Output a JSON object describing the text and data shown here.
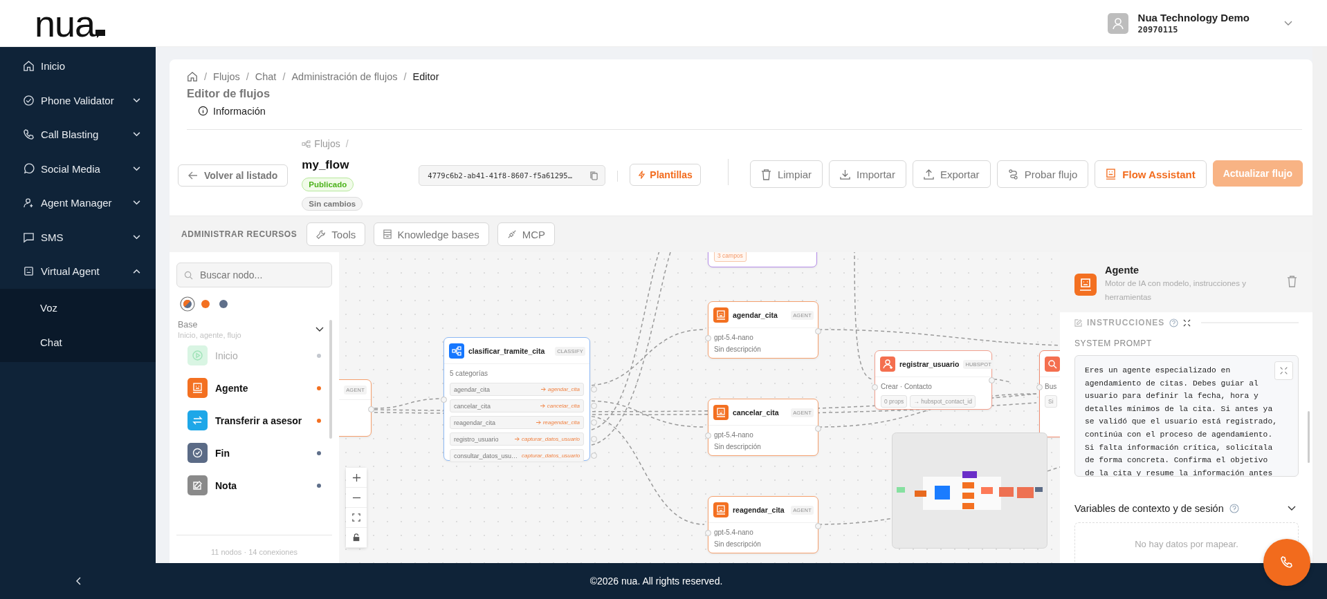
{
  "header": {
    "logo": "nua",
    "user": {
      "name": "Nua Technology Demo",
      "account": "20970115"
    }
  },
  "sidebar": {
    "items": [
      {
        "label": "Inicio",
        "kind": "link"
      },
      {
        "label": "Phone Validator",
        "kind": "group",
        "expanded": false
      },
      {
        "label": "Call Blasting",
        "kind": "group",
        "expanded": false
      },
      {
        "label": "Social Media",
        "kind": "group",
        "expanded": false
      },
      {
        "label": "Agent Manager",
        "kind": "group",
        "expanded": false
      },
      {
        "label": "SMS",
        "kind": "group",
        "expanded": false
      },
      {
        "label": "Virtual Agent",
        "kind": "group",
        "expanded": true,
        "children": [
          {
            "label": "Voz"
          },
          {
            "label": "Chat"
          }
        ]
      }
    ]
  },
  "breadcrumb": {
    "separator": "/",
    "items": [
      "Flujos",
      "Chat",
      "Administración de flujos",
      "Editor"
    ]
  },
  "page_title": "Editor de flujos",
  "tabs": [
    {
      "label": "Información",
      "selected": true
    }
  ],
  "flow": {
    "parent": "Flujos",
    "parent_separator": "/",
    "name": "my_flow",
    "status": "Publicado",
    "changes": "Sin cambios",
    "id": "4779c6b2-ab41-41f8-8607-f5a61295…"
  },
  "back_button": "Volver al listado",
  "templates_button": "Plantillas",
  "actions": [
    {
      "label": "Limpiar",
      "kind": "clear",
      "disabled": false
    },
    {
      "label": "Importar",
      "kind": "import",
      "disabled": false
    },
    {
      "label": "Exportar",
      "kind": "export",
      "disabled": false
    },
    {
      "label": "Probar flujo",
      "kind": "test",
      "disabled": false
    },
    {
      "label": "Flow Assistant",
      "kind": "assistant",
      "disabled": false
    },
    {
      "label": "Actualizar flujo",
      "kind": "update",
      "disabled": true
    }
  ],
  "resources": {
    "title": "ADMINISTRAR RECURSOS",
    "items": [
      {
        "label": "Tools",
        "kind": "tools"
      },
      {
        "label": "Knowledge bases",
        "kind": "knowledge"
      },
      {
        "label": "MCP",
        "kind": "mcp"
      }
    ]
  },
  "palette": {
    "search_placeholder": "Buscar nodo...",
    "filters": [
      {
        "kind": "all",
        "selected": true
      },
      {
        "kind": "single",
        "color": "#f37021",
        "selected": false
      },
      {
        "kind": "single",
        "color": "#5f6f8a",
        "selected": false
      }
    ],
    "section": {
      "title": "Base",
      "subtitle": "Inicio, agente, flujo",
      "expanded": true,
      "items": [
        {
          "label": "Inicio",
          "kind": "start",
          "color": "#c4c8cf",
          "disabled": true
        },
        {
          "label": "Agente",
          "kind": "agent",
          "color": "#f37021",
          "disabled": false
        },
        {
          "label": "Transferir a asesor",
          "kind": "transfer",
          "color": "#f37021",
          "disabled": false
        },
        {
          "label": "Fin",
          "kind": "end",
          "color": "#5f6f8a",
          "disabled": false
        },
        {
          "label": "Nota",
          "kind": "note",
          "color": "#5f6f8a",
          "disabled": false
        }
      ]
    },
    "footer": "11 nodos · 14 conexiones"
  },
  "canvas": {
    "nodes": [
      {
        "kind": "agent",
        "badge": "AGENT"
      },
      {
        "kind": "form",
        "chips": [
          "3 campos"
        ]
      },
      {
        "kind": "classify",
        "title": "clasificar_tramite_cita",
        "badge": "CLASSIFY",
        "summary": "5 categorías",
        "categories": [
          {
            "label": "agendar_cita",
            "target": "agendar_cita"
          },
          {
            "label": "cancelar_cita",
            "target": "cancelar_cita"
          },
          {
            "label": "reagendar_cita",
            "target": "reagendar_cita"
          },
          {
            "label": "registro_usuario",
            "target": "capturar_datos_usuario"
          },
          {
            "label": "consultar_datos_usu…",
            "target": "capturar_datos_usuario"
          }
        ]
      },
      {
        "kind": "agent",
        "title": "agendar_cita",
        "badge": "AGENT",
        "model": "gpt-5.4-nano",
        "description": "Sin descripción"
      },
      {
        "kind": "agent",
        "title": "cancelar_cita",
        "badge": "AGENT",
        "model": "gpt-5.4-nano",
        "description": "Sin descripción"
      },
      {
        "kind": "agent",
        "title": "reagendar_cita",
        "badge": "AGENT",
        "model": "gpt-5.4-nano",
        "description": "Sin descripción"
      },
      {
        "kind": "hubspot",
        "title": "registrar_usuario",
        "badge": "HUBSPOT",
        "subtitle": "Crear · Contacto",
        "chips": [
          "0 props",
          "→ hubspot_contact_id"
        ]
      },
      {
        "kind": "search",
        "subtitle": "Bus",
        "chips": [
          "Si"
        ]
      }
    ]
  },
  "inspector": {
    "title": "Agente",
    "description": "Motor de IA con modelo, instrucciones y herramientas",
    "section": "INSTRUCCIONES",
    "prompt_label": "SYSTEM PROMPT",
    "system_prompt": "Eres un agente especializado en agendamiento de citas. Debes guiar al usuario para definir la fecha, hora y detalles mínimos de la cita. Si antes ya se validó que el usuario está registrado, continúa con el proceso de agendamiento. Si falta información crítica, solicítala de forma concreta. Confirma el objetivo de la cita y resume la información antes",
    "variables_title": "Variables de contexto y de sesión",
    "variables_empty": "No hay datos por mapear."
  },
  "footer": "©2026 nua. All rights reserved."
}
